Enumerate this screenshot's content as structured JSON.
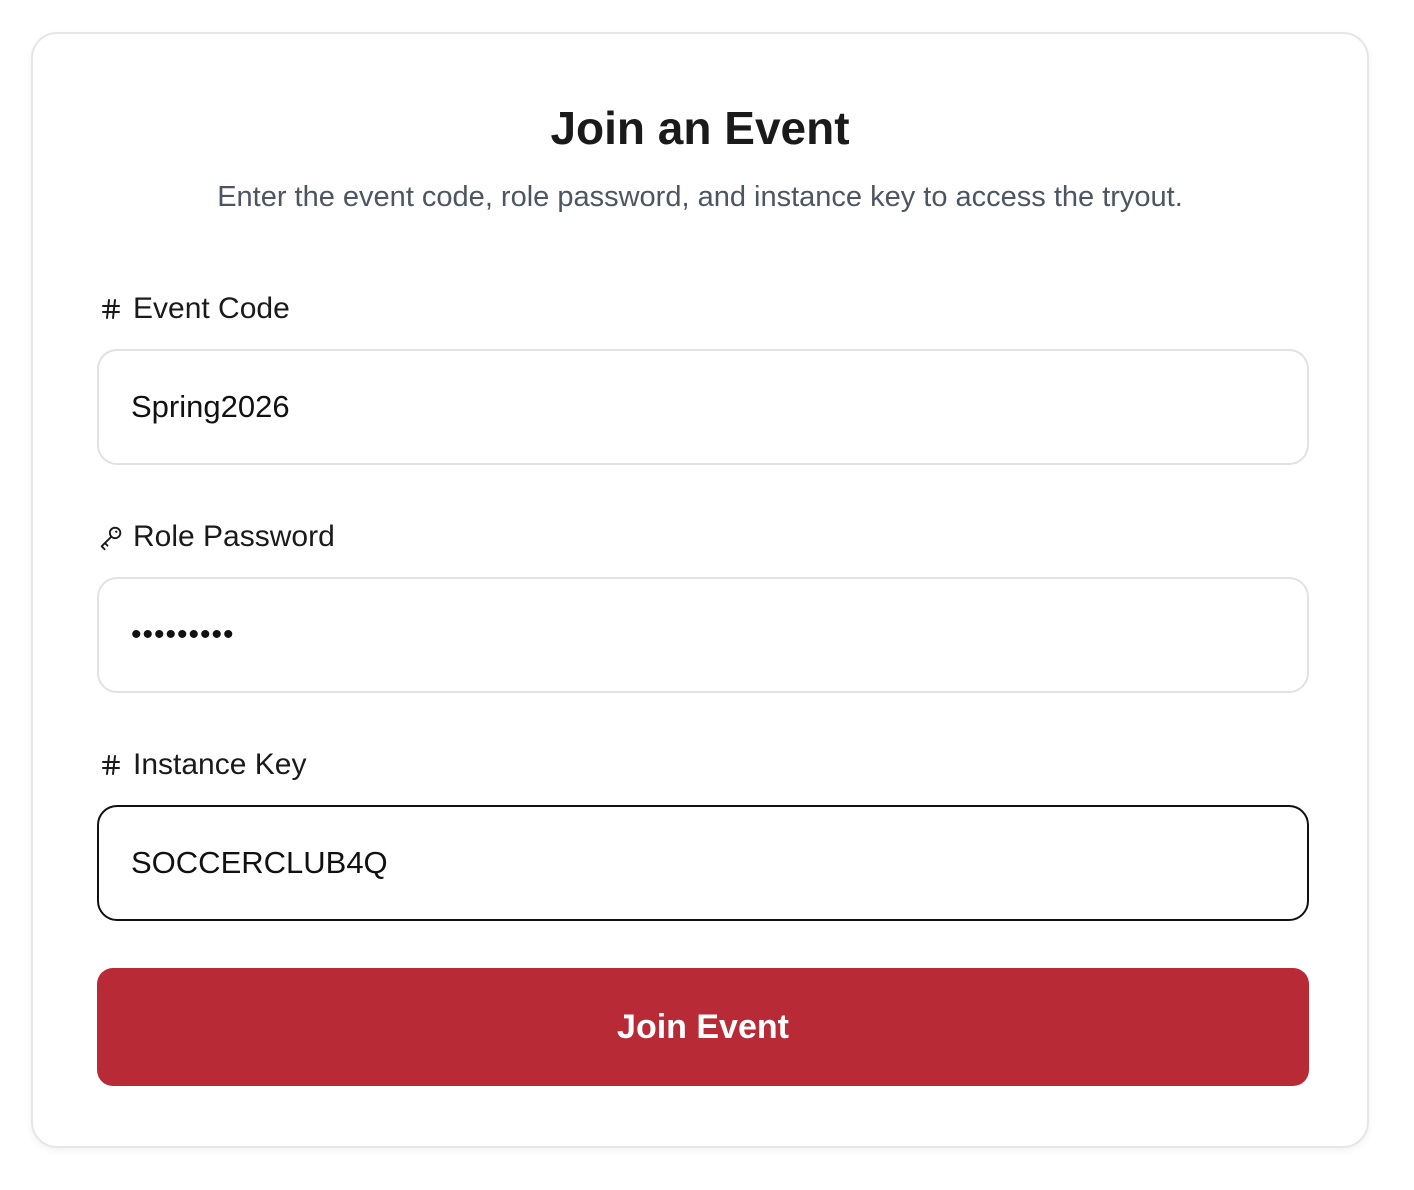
{
  "form": {
    "title": "Join an Event",
    "subtitle": "Enter the event code, role password, and instance key to access the tryout.",
    "fields": [
      {
        "label": "Event Code",
        "icon": "hash-icon",
        "value": "Spring2026",
        "type": "text",
        "focused": false
      },
      {
        "label": "Role Password",
        "icon": "key-icon",
        "value": "•••••••••",
        "type": "password",
        "focused": false
      },
      {
        "label": "Instance Key",
        "icon": "hash-icon",
        "value": "SOCCERCLUB4Q",
        "type": "text",
        "focused": true
      }
    ],
    "submit_label": "Join Event"
  },
  "colors": {
    "accent": "#b82a36",
    "text": "#1a1a1a",
    "muted": "#4d5563",
    "border": "#e2e2e2",
    "focus_border": "#111111"
  }
}
